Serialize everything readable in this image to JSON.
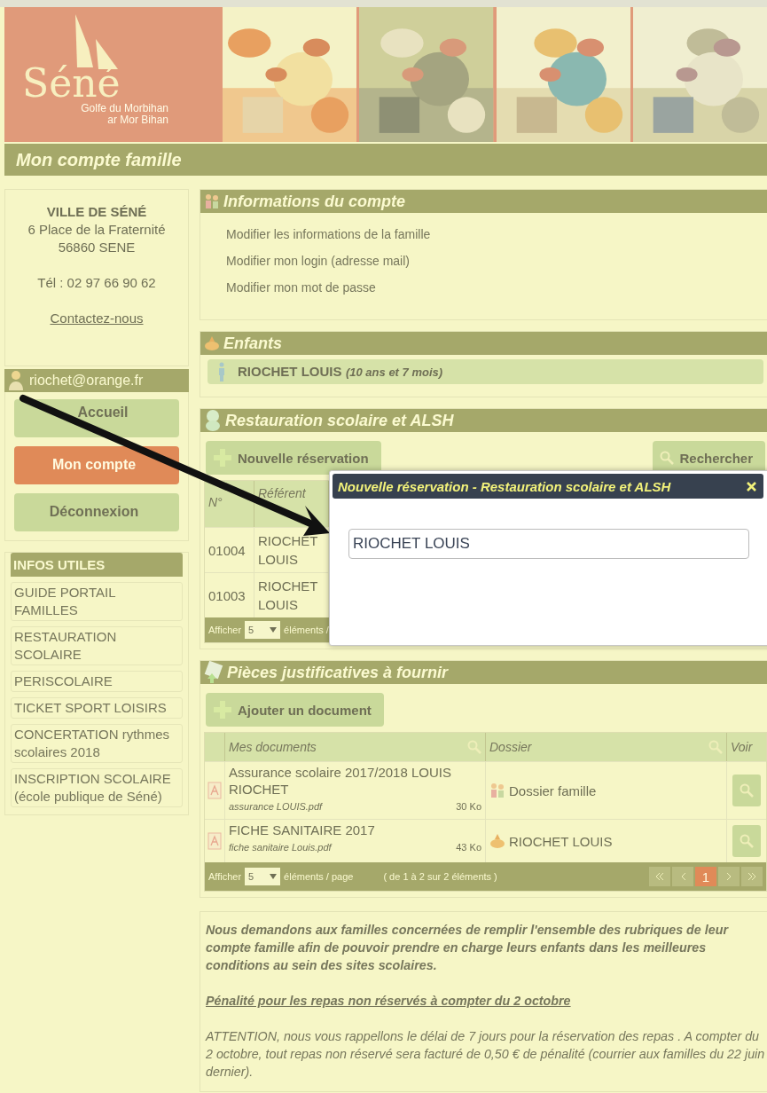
{
  "header": {
    "logo": {
      "name": "Séné",
      "line1": "Golfe du Morbihan",
      "line2": "ar Mor Bihan"
    }
  },
  "page_title": "Mon compte famille",
  "sidebar": {
    "contact": {
      "name": "VILLE DE SÉNÉ",
      "address": "6 Place de la Fraternité",
      "city": "56860 SENE",
      "phone": "Tél : 02 97 66 90 62",
      "link": "Contactez-nous"
    },
    "user": {
      "email": "riochet@orange.fr"
    },
    "nav": [
      {
        "label": "Accueil",
        "selected": false
      },
      {
        "label": "Mon compte",
        "selected": true
      },
      {
        "label": "Déconnexion",
        "selected": false
      }
    ],
    "infos": {
      "title": "INFOS UTILES",
      "links": [
        "GUIDE PORTAIL FAMILLES",
        "RESTAURATION SCOLAIRE",
        "PERISCOLAIRE",
        "TICKET SPORT LOISIRS",
        "CONCERTATION rythmes scolaires 2018",
        "INSCRIPTION SCOLAIRE (école publique de Séné)"
      ]
    }
  },
  "account": {
    "title": "Informations du compte",
    "links": [
      "Modifier les informations de la famille",
      "Modifier mon login (adresse mail)",
      "Modifier mon mot de passe"
    ]
  },
  "children": {
    "title": "Enfants",
    "items": [
      {
        "name": "RIOCHET LOUIS",
        "age": "(10 ans et 7 mois)"
      }
    ]
  },
  "restauration": {
    "title": "Restauration scolaire et ALSH",
    "new_button": "Nouvelle réservation",
    "search_button": "Rechercher",
    "columns": [
      "N°",
      "Référent"
    ],
    "rows": [
      {
        "number": "01004",
        "referent": "RIOCHET LOUIS"
      },
      {
        "number": "01003",
        "referent": "RIOCHET LOUIS"
      }
    ],
    "footer": {
      "show_label": "Afficher",
      "page_size": "5",
      "per_page": "éléments /"
    }
  },
  "documents": {
    "title": "Pièces justificatives à fournir",
    "add_button": "Ajouter un document",
    "columns": [
      "Mes documents",
      "Dossier",
      "Voir"
    ],
    "rows": [
      {
        "title": "Assurance scolaire 2017/2018 LOUIS RIOCHET",
        "file": "assurance LOUIS.pdf",
        "size": "30 Ko",
        "folder": "Dossier famille",
        "kind": "family"
      },
      {
        "title": "FICHE SANITAIRE 2017",
        "file": "fiche sanitaire Louis.pdf",
        "size": "43 Ko",
        "folder": "RIOCHET LOUIS",
        "kind": "child"
      }
    ],
    "footer": {
      "show_label": "Afficher",
      "page_size": "5",
      "per_page": "éléments / page",
      "summary": "( de 1 à 2 sur 2 éléments )",
      "pages": [
        {
          "label": "1",
          "selected": true
        }
      ]
    }
  },
  "notice": {
    "intro": "Nous demandons aux familles concernées de remplir l'ensemble des rubriques de leur compte famille afin de pouvoir prendre en charge leurs enfants dans les meilleures conditions au sein des sites scolaires.",
    "heading": "Pénalité pour les repas non réservés à compter du 2 octobre",
    "body": "ATTENTION, nous vous rappellons le délai de 7 jours pour la réservation des repas . A compter du 2 octobre, tout repas non réservé sera facturé de 0,50 € de pénalité (courrier aux familles du 22 juin dernier)."
  },
  "dialog": {
    "title": "Nouvelle réservation - Restauration scolaire et ALSH",
    "value": "RIOCHET LOUIS"
  }
}
